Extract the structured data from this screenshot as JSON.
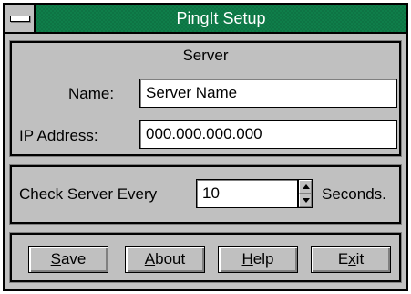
{
  "window": {
    "title": "PingIt Setup"
  },
  "server_group": {
    "caption": "Server",
    "name_label": "Name:",
    "name_value": "Server Name",
    "ip_label": "IP Address:",
    "ip_value": "000.000.000.000"
  },
  "check_group": {
    "prefix": "Check Server Every",
    "interval_value": "10",
    "suffix": "Seconds."
  },
  "buttons": {
    "save": {
      "mnemonic": "S",
      "rest": "ave"
    },
    "about": {
      "mnemonic": "A",
      "rest": "bout"
    },
    "help": {
      "mnemonic": "H",
      "rest": "elp"
    },
    "exit": {
      "pre": "E",
      "mnemonic": "x",
      "rest": "it"
    }
  },
  "icons": {
    "system_menu": "system-menu-icon",
    "spin_up": "spin-up-arrow-icon",
    "spin_down": "spin-down-arrow-icon"
  },
  "colors": {
    "titlebar": "#0f7e4a",
    "face": "#c0c0c0"
  }
}
